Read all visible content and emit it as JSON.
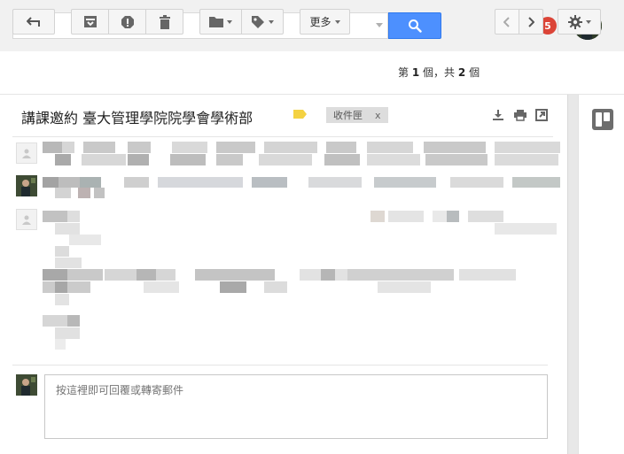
{
  "search": {
    "value": "",
    "placeholder": ""
  },
  "header": {
    "notification_count": "5",
    "icons": [
      "search-icon",
      "apps-grid-icon",
      "account-avatar"
    ]
  },
  "toolbar": {
    "back_icon": "back-arrow-icon",
    "archive_icon": "archive-icon",
    "spam_icon": "report-spam-icon",
    "delete_icon": "trash-icon",
    "move_icon": "folder-icon",
    "labels_icon": "label-icon",
    "more_label": "更多",
    "settings_icon": "gear-icon"
  },
  "pager": {
    "prefix": "第",
    "current": "1",
    "sep": "個，共",
    "total": "2",
    "suffix": "個"
  },
  "thread": {
    "subject": "講課邀約 臺大管理學院院學會學術部",
    "inbox_chip": "收件匣",
    "inbox_chip_close": "x",
    "label_color": "#f4d242",
    "icons": [
      "expand-all-icon",
      "print-icon",
      "open-in-new-window-icon"
    ]
  },
  "reply": {
    "placeholder": "按這裡即可回覆或轉寄郵件"
  },
  "side_panel": {
    "addon_icon": "trello-icon"
  },
  "colors": {
    "accent": "#4d90fe",
    "badge": "#db4437",
    "topbar": "#f1f1f1"
  }
}
